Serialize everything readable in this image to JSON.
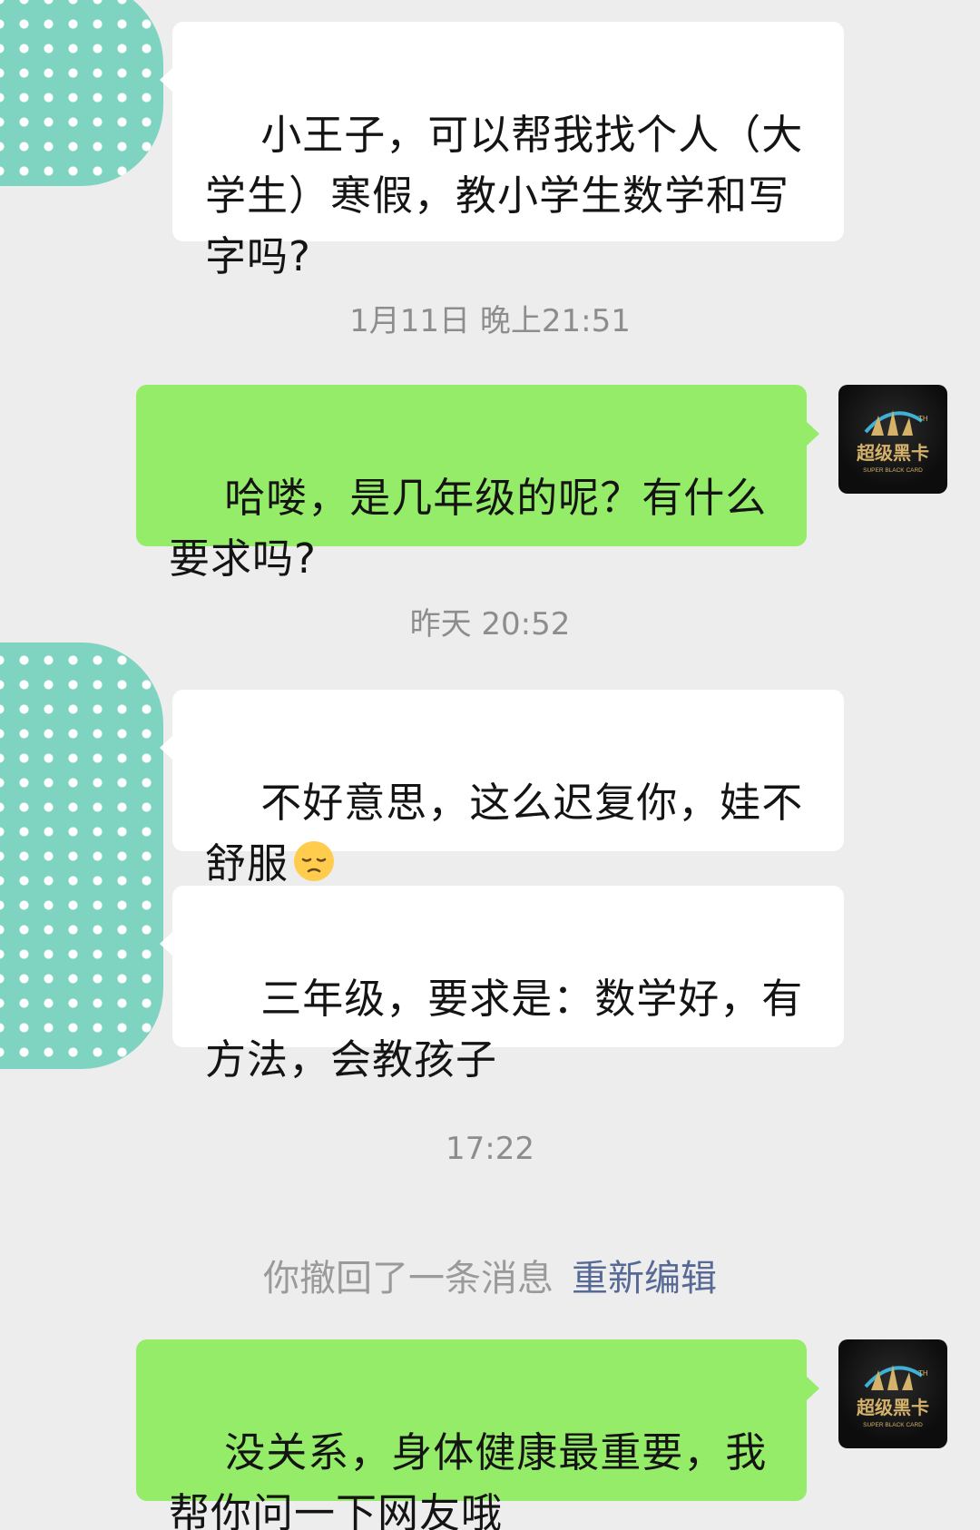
{
  "messages": [
    {
      "type": "received",
      "text": "小王子，可以帮我找个人（大学生）寒假，教小学生数学和写字吗?"
    },
    {
      "type": "timestamp",
      "text": "1月11日 晚上21:51"
    },
    {
      "type": "sent",
      "text": "哈喽，是几年级的呢？有什么要求吗?"
    },
    {
      "type": "timestamp",
      "text": "昨天 20:52"
    },
    {
      "type": "received",
      "text": "不好意思，这么迟复你，娃不舒服",
      "emoji": "pensive-face"
    },
    {
      "type": "received",
      "text": "三年级，要求是：数学好，有方法，会教孩子"
    },
    {
      "type": "timestamp",
      "text": "17:22"
    },
    {
      "type": "system",
      "text": "你撤回了一条消息",
      "link": "重新编辑"
    },
    {
      "type": "sent",
      "text": "没关系，身体健康最重要，我帮你问一下网友哦"
    }
  ],
  "self_avatar": {
    "logo_mark": "TH",
    "logo_title": "超级黑卡",
    "logo_subtitle": "SUPER BLACK CARD"
  },
  "colors": {
    "background": "#ededed",
    "sent_bubble": "#95ec69",
    "received_bubble": "#ffffff",
    "link": "#566a95",
    "avatar_blob": "#7fd3c1",
    "logo_gold": "#d4b26a"
  }
}
